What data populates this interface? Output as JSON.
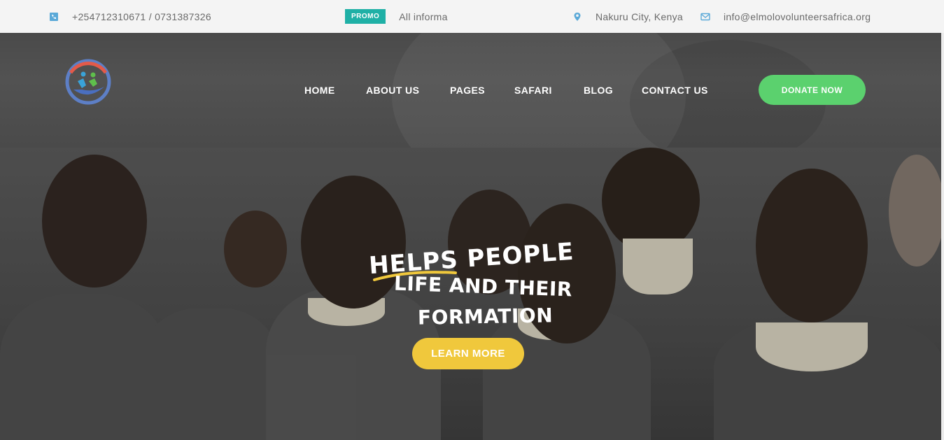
{
  "topbar": {
    "phone": "+254712310671 / 0731387326",
    "promo_badge": "PROMO",
    "promo_text": "All informa",
    "location": "Nakuru City, Kenya",
    "email": "info@elmolovolunteersafrica.org",
    "icon_color": "#5aa9d8"
  },
  "nav": {
    "items": [
      "HOME",
      "ABOUT US",
      "PAGES",
      "SAFARI",
      "BLOG",
      "CONTACT US"
    ],
    "donate_label": "DONATE NOW"
  },
  "hero": {
    "line1": "Helps People",
    "line2": "Life and Their",
    "line3": "Formation",
    "cta_label": "LEARN MORE"
  },
  "colors": {
    "accent_green": "#5bd16e",
    "accent_yellow": "#f0c83c",
    "promo_teal": "#1fb0a6"
  }
}
